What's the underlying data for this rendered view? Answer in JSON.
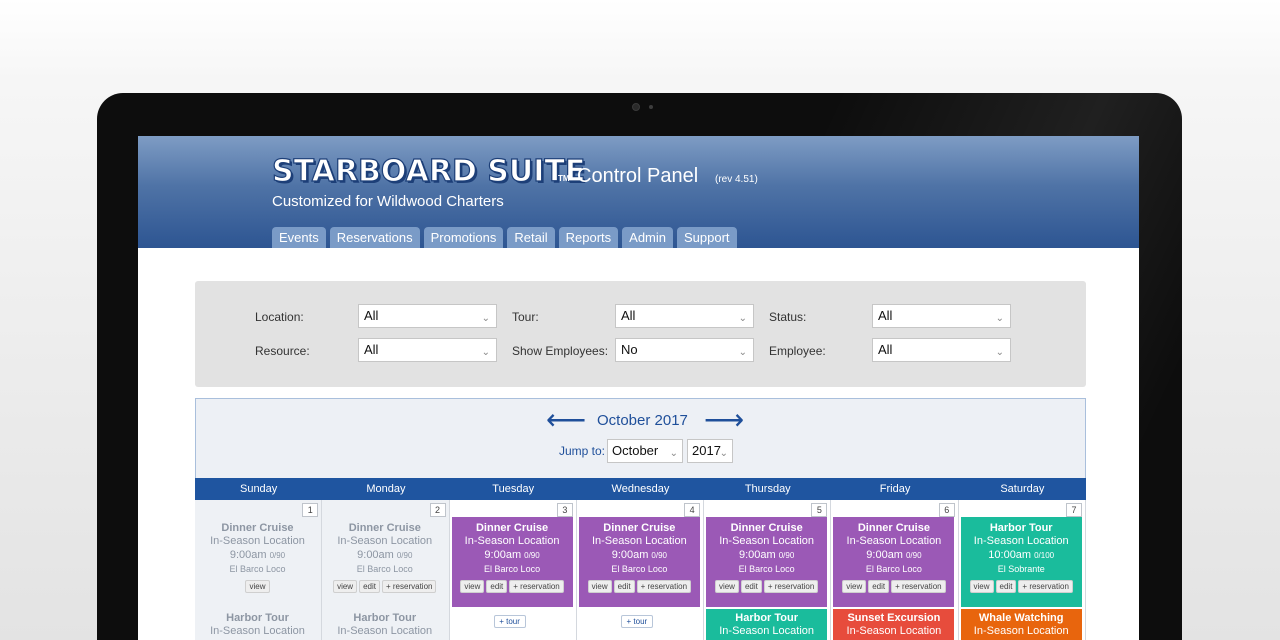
{
  "header": {
    "brand": "STARBOARD SUITE",
    "tm": "TM",
    "title": "Control Panel",
    "revision": "(rev 4.51)",
    "subtitle": "Customized for Wildwood Charters"
  },
  "nav": {
    "tabs": [
      "Events",
      "Reservations",
      "Promotions",
      "Retail",
      "Reports",
      "Admin",
      "Support"
    ]
  },
  "filters": {
    "location": {
      "label": "Location:",
      "value": "All"
    },
    "tour": {
      "label": "Tour:",
      "value": "All"
    },
    "status": {
      "label": "Status:",
      "value": "All"
    },
    "resource": {
      "label": "Resource:",
      "value": "All"
    },
    "show_employees": {
      "label": "Show Employees:",
      "value": "No"
    },
    "employee": {
      "label": "Employee:",
      "value": "All"
    }
  },
  "calendar": {
    "month_title": "October 2017",
    "prev_arrow": "⟵",
    "next_arrow": "⟶",
    "jump_label": "Jump to:",
    "jump_month": "October",
    "jump_year": "2017",
    "day_names": [
      "Sunday",
      "Monday",
      "Tuesday",
      "Wednesday",
      "Thursday",
      "Friday",
      "Saturday"
    ],
    "days": [
      {
        "num": "1",
        "past": true,
        "event": {
          "title": "Dinner Cruise",
          "location": "In-Season Location",
          "time": "9:00am",
          "capacity": "0/90",
          "boat": "El Barco Loco",
          "color": "#eef1f5"
        },
        "actions": [
          "view"
        ],
        "next_event": {
          "title": "Harbor Tour",
          "location": "In-Season Location"
        }
      },
      {
        "num": "2",
        "past": true,
        "event": {
          "title": "Dinner Cruise",
          "location": "In-Season Location",
          "time": "9:00am",
          "capacity": "0/90",
          "boat": "El Barco Loco",
          "color": "#eef1f5"
        },
        "actions": [
          "view",
          "edit",
          "+ reservation"
        ],
        "next_event": {
          "title": "Harbor Tour",
          "location": "In-Season Location"
        }
      },
      {
        "num": "3",
        "past": false,
        "event": {
          "title": "Dinner Cruise",
          "location": "In-Season Location",
          "time": "9:00am",
          "capacity": "0/90",
          "boat": "El Barco Loco",
          "color": "#9b59b6"
        },
        "actions": [
          "view",
          "edit",
          "+ reservation"
        ],
        "add_tour": "+ tour"
      },
      {
        "num": "4",
        "past": false,
        "event": {
          "title": "Dinner Cruise",
          "location": "In-Season Location",
          "time": "9:00am",
          "capacity": "0/90",
          "boat": "El Barco Loco",
          "color": "#9b59b6"
        },
        "actions": [
          "view",
          "edit",
          "+ reservation"
        ],
        "add_tour": "+ tour"
      },
      {
        "num": "5",
        "past": false,
        "event": {
          "title": "Dinner Cruise",
          "location": "In-Season Location",
          "time": "9:00am",
          "capacity": "0/90",
          "boat": "El Barco Loco",
          "color": "#9b59b6"
        },
        "actions": [
          "view",
          "edit",
          "+ reservation"
        ],
        "next_event": {
          "title": "Harbor Tour",
          "location": "In-Season Location",
          "color": "#1abc9c"
        }
      },
      {
        "num": "6",
        "past": false,
        "event": {
          "title": "Dinner Cruise",
          "location": "In-Season Location",
          "time": "9:00am",
          "capacity": "0/90",
          "boat": "El Barco Loco",
          "color": "#9b59b6"
        },
        "actions": [
          "view",
          "edit",
          "+ reservation"
        ],
        "next_event": {
          "title": "Sunset Excursion",
          "location": "In-Season Location",
          "color": "#e74c3c"
        }
      },
      {
        "num": "7",
        "past": false,
        "event": {
          "title": "Harbor Tour",
          "location": "In-Season Location",
          "time": "10:00am",
          "capacity": "0/100",
          "boat": "El Sobrante",
          "color": "#1abc9c"
        },
        "actions": [
          "view",
          "edit",
          "+ reservation"
        ],
        "next_event": {
          "title": "Whale Watching",
          "location": "In-Season Location",
          "color": "#e8650d"
        }
      }
    ]
  }
}
